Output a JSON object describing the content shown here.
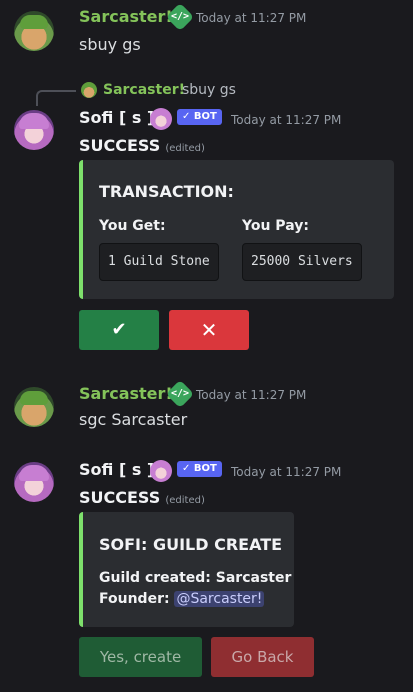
{
  "messages": [
    {
      "author": "Sarcaster!",
      "timestamp": "Today at 11:27 PM",
      "content": "sbuy gs",
      "badge_icon": "dev-badge-icon"
    },
    {
      "reply": {
        "author": "Sarcaster!",
        "content": "sbuy gs"
      },
      "author": "Sofi [ s ]",
      "bot_tag": "✓ BOT",
      "timestamp": "Today at 11:27 PM",
      "heading": "SUCCESS",
      "edited": "(edited)",
      "embed": {
        "title": "TRANSACTION:",
        "fields": [
          {
            "name": "You Get:",
            "value": "1 Guild Stone"
          },
          {
            "name": "You Pay:",
            "value": "25000 Silvers"
          }
        ]
      },
      "buttons": [
        {
          "label": "✔",
          "style": "success"
        },
        {
          "label": "✕",
          "style": "danger"
        }
      ]
    },
    {
      "author": "Sarcaster!",
      "timestamp": "Today at 11:27 PM",
      "content": "sgc Sarcaster",
      "badge_icon": "dev-badge-icon"
    },
    {
      "author": "Sofi [ s ]",
      "bot_tag": "✓ BOT",
      "timestamp": "Today at 11:27 PM",
      "heading": "SUCCESS",
      "edited": "(edited)",
      "embed": {
        "title": "SOFI: GUILD CREATE",
        "line1_label": "Guild created: Sarcaster",
        "line2_label": "Founder:",
        "line2_mention": "@Sarcaster!"
      },
      "buttons": [
        {
          "label": "Yes, create",
          "style": "success-disabled"
        },
        {
          "label": "Go Back",
          "style": "danger-disabled"
        }
      ]
    }
  ],
  "colors": {
    "background": "#1a1a1e",
    "user_name": "#84c35a",
    "embed_accent": "#7ee06c",
    "bot_tag": "#5865f2",
    "success_button": "#248046",
    "danger_button": "#da373c"
  }
}
